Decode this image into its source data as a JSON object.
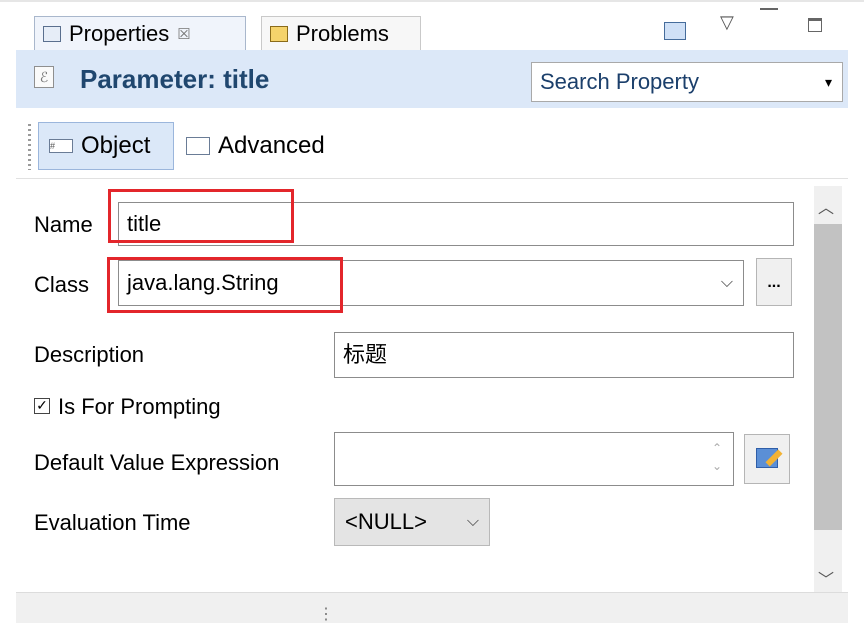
{
  "tabs": {
    "properties": "Properties",
    "properties_close": "☒",
    "problems": "Problems"
  },
  "header": {
    "title": "Parameter: title",
    "search_placeholder": "Search Property",
    "search_arrow": "▾"
  },
  "subtabs": {
    "object": "Object",
    "advanced": "Advanced"
  },
  "form": {
    "name_label": "Name",
    "name_value": "title",
    "class_label": "Class",
    "class_value": "java.lang.String",
    "class_browse": "...",
    "description_label": "Description",
    "description_value": "标题",
    "prompting_label": "Is For Prompting",
    "prompting_checked": true,
    "default_label": "Default Value Expression",
    "default_value": "",
    "eval_label": "Evaluation Time",
    "eval_value": "<NULL>"
  },
  "icons": [
    "properties-icon",
    "problems-icon",
    "view-menu-icon",
    "minimize-icon",
    "maximize-icon",
    "parameter-icon",
    "object-icon",
    "advanced-icon",
    "expression-editor-icon"
  ],
  "colors": {
    "highlight": "#e3262b",
    "header_bg": "#dce8f8",
    "title_color": "#20476f"
  }
}
